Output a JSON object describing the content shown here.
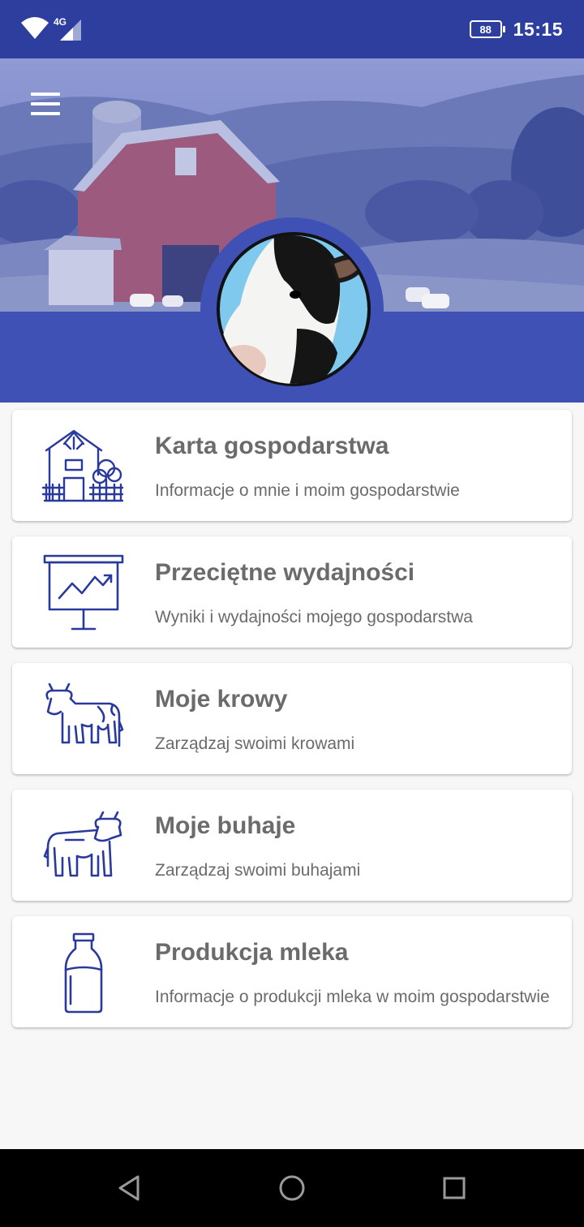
{
  "status_bar": {
    "network": "4G",
    "battery": "88",
    "time": "15:15"
  },
  "header": {
    "menu_icon": "hamburger-menu-icon",
    "avatar_icon": "cow-head-avatar"
  },
  "menu": [
    {
      "icon": "farmhouse-icon",
      "title": "Karta gospodarstwa",
      "subtitle": "Informacje o mnie i moim gospodarstwie"
    },
    {
      "icon": "presentation-chart-icon",
      "title": "Przeciętne wydajności",
      "subtitle": "Wyniki i wydajności mojego gospodarstwa"
    },
    {
      "icon": "cow-icon",
      "title": "Moje krowy",
      "subtitle": "Zarządzaj swoimi krowami"
    },
    {
      "icon": "bull-icon",
      "title": "Moje buhaje",
      "subtitle": "Zarządzaj swoimi buhajami"
    },
    {
      "icon": "milk-bottle-icon",
      "title": "Produkcja mleka",
      "subtitle": "Informacje o produkcji mleka w moim gospodarstwie"
    }
  ],
  "colors": {
    "status_bar": "#2e3e9f",
    "primary": "#3f51b5",
    "icon_stroke": "#2a3a9c",
    "text": "#6b6b6b"
  }
}
